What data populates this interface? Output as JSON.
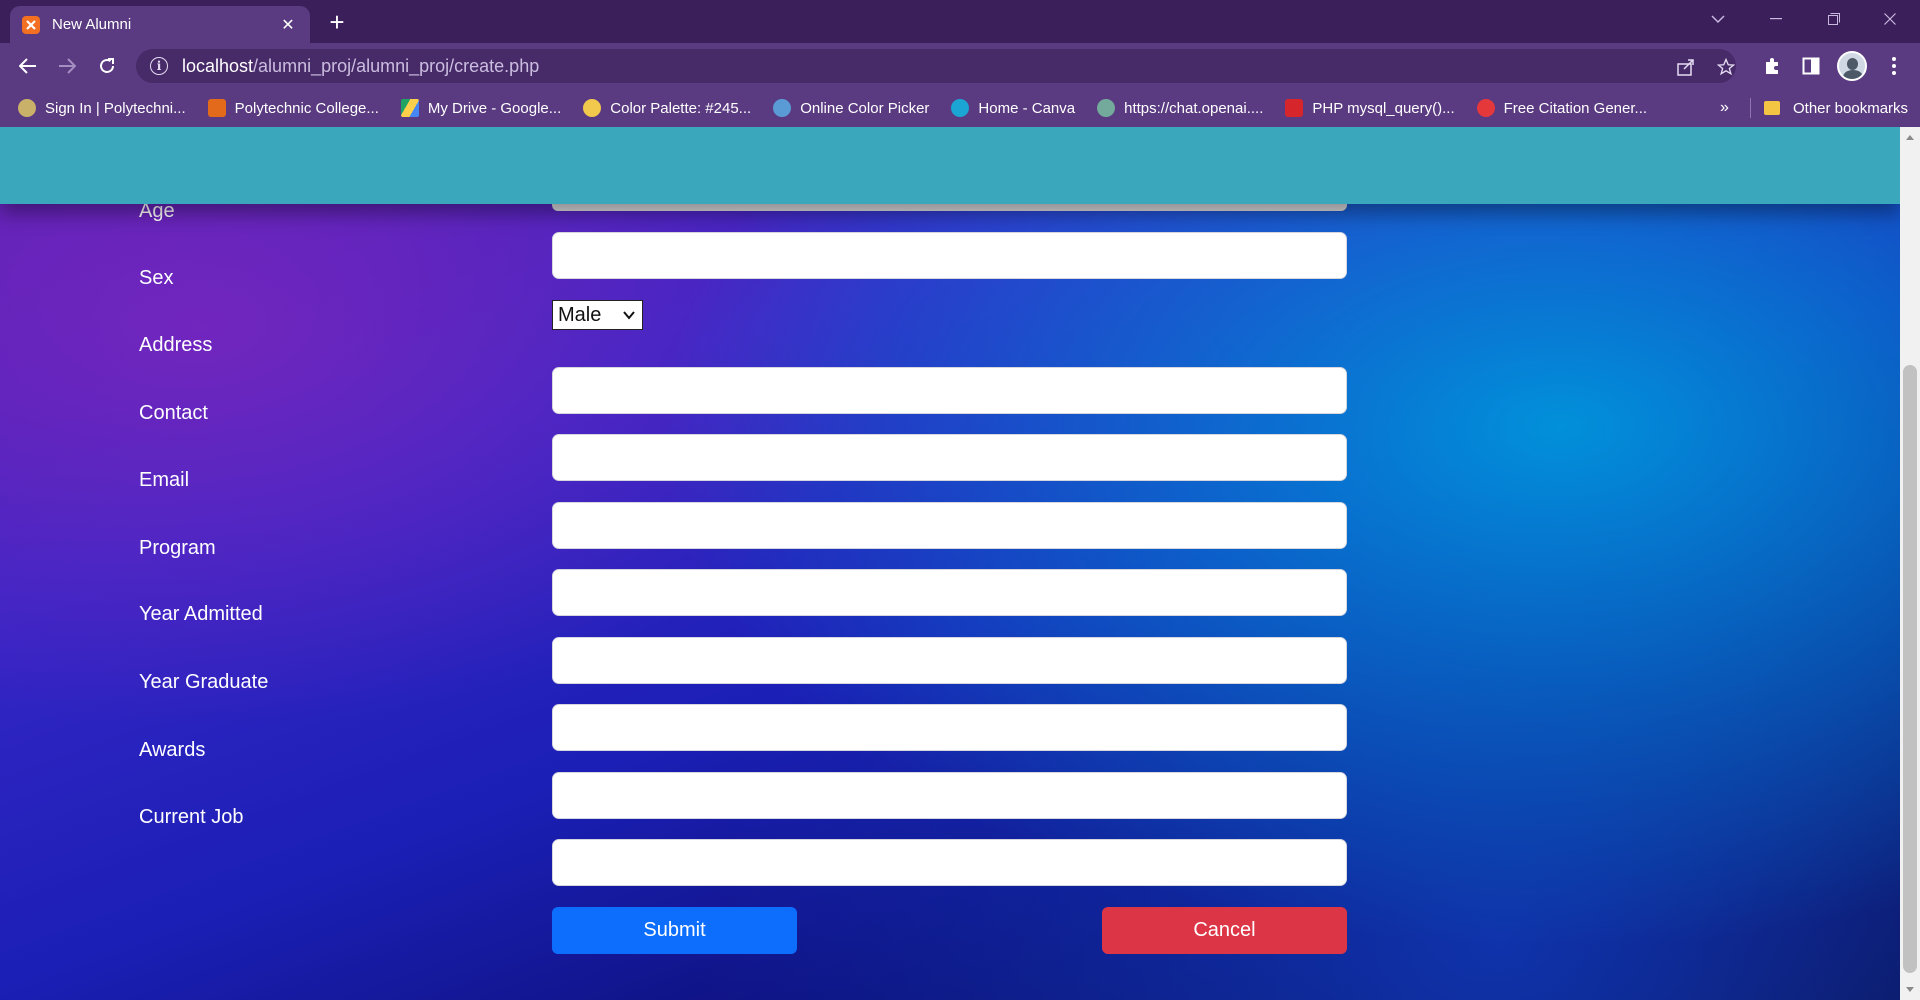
{
  "browser": {
    "tab": {
      "title": "New Alumni",
      "favicon": "xampp-icon"
    },
    "address": {
      "host": "localhost",
      "path": "/alumni_proj/alumni_proj/create.php"
    },
    "bookmarks": [
      {
        "label": "Sign In | Polytechni...",
        "icon": "globe-icon",
        "color": "#c9b16a"
      },
      {
        "label": "Polytechnic College...",
        "icon": "college-icon",
        "color": "#e46a1b"
      },
      {
        "label": "My Drive - Google...",
        "icon": "drive-icon",
        "color": "#1fa463"
      },
      {
        "label": "Color Palette: #245...",
        "icon": "palette-icon",
        "color": "#f2c94c"
      },
      {
        "label": "Online Color Picker",
        "icon": "picker-icon",
        "color": "#5b9bd5"
      },
      {
        "label": "Home - Canva",
        "icon": "canva-icon",
        "color": "#1aa5d4"
      },
      {
        "label": "https://chat.openai....",
        "icon": "openai-icon",
        "color": "#74aa9c"
      },
      {
        "label": "PHP mysql_query()...",
        "icon": "php-icon",
        "color": "#d7262b"
      },
      {
        "label": "Free Citation Gener...",
        "icon": "citation-icon",
        "color": "#e5383b"
      }
    ],
    "more_label": "»",
    "other_bookmarks": "Other bookmarks"
  },
  "form": {
    "fields": [
      {
        "label": "Age",
        "value": ""
      },
      {
        "label": "Sex",
        "value": "Male",
        "type": "select"
      },
      {
        "label": "Address",
        "value": ""
      },
      {
        "label": "Contact",
        "value": ""
      },
      {
        "label": "Email",
        "value": ""
      },
      {
        "label": "Program",
        "value": ""
      },
      {
        "label": "Year Admitted",
        "value": ""
      },
      {
        "label": "Year Graduate",
        "value": ""
      },
      {
        "label": "Awards",
        "value": ""
      },
      {
        "label": "Current Job",
        "value": ""
      }
    ],
    "submit_label": "Submit",
    "cancel_label": "Cancel"
  },
  "colors": {
    "header": "#3aa7bd",
    "submit": "#0d6efd",
    "cancel": "#dc3545",
    "chrome": "#5a3a80"
  }
}
